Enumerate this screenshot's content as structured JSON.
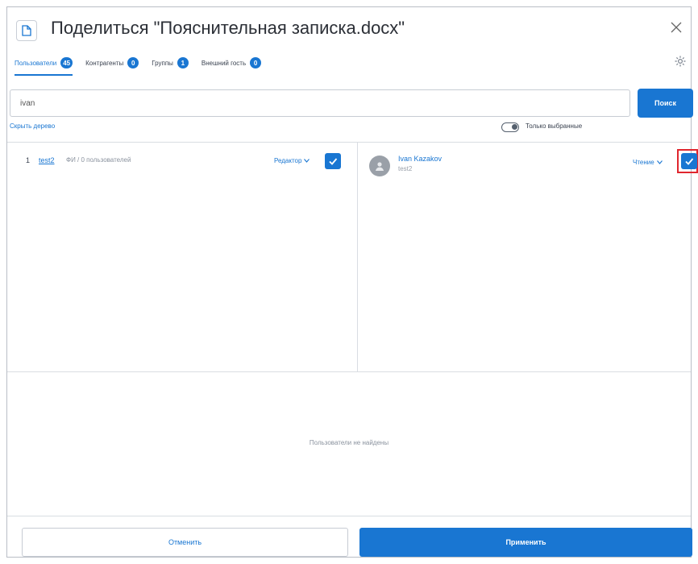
{
  "header": {
    "title": "Поделиться \"Пояснительная записка.docx\"",
    "doc_icon": "document-icon",
    "close_icon": "close-icon",
    "settings_icon": "gear-icon"
  },
  "tabs": [
    {
      "label": "Пользователи",
      "count": "45",
      "active": true
    },
    {
      "label": "Контрагенты",
      "count": "0",
      "active": false
    },
    {
      "label": "Группы",
      "count": "1",
      "active": false
    },
    {
      "label": "Внешний гость",
      "count": "0",
      "active": false
    }
  ],
  "search": {
    "value": "ivan",
    "button_label": "Поиск"
  },
  "filters": {
    "hide_tree_label": "Скрыть дерево",
    "only_selected_label": "Только выбранные",
    "only_selected_on": false
  },
  "left_list": {
    "rows": [
      {
        "number": "1",
        "login": "test2",
        "info": "ФИ / 0 пользователей",
        "role": "Редактор",
        "checked": true
      }
    ]
  },
  "right_list": {
    "users": [
      {
        "name": "Ivan Kazakov",
        "login": "test2",
        "role": "Чтение",
        "checked": true
      }
    ]
  },
  "empty_message": "Пользователи не найдены",
  "footer": {
    "cancel_label": "Отменить",
    "apply_label": "Применить"
  },
  "colors": {
    "accent": "#1976d2",
    "highlight": "#e0262e"
  }
}
